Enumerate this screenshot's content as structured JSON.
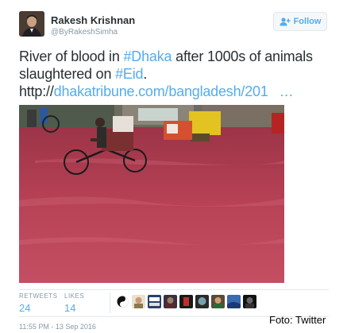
{
  "author": {
    "name": "Rakesh Krishnan",
    "handle": "@ByRakeshSimha",
    "avatar_icon": "profile-photo"
  },
  "follow_button": {
    "label": "Follow",
    "icon": "add-user-icon"
  },
  "tweet": {
    "line1_prefix": "River of blood in ",
    "hashtag1": "#Dhaka",
    "line1_suffix": " after 1000s of animals",
    "line2_prefix": "slaughtered on ",
    "hashtag2": "#Eid",
    "line2_suffix": ".",
    "url_scheme": "http://",
    "url_text": "dhakatribune.com/bangladesh/201",
    "ellipsis": "…"
  },
  "photo": {
    "description_icon": "flooded-street-photo"
  },
  "stats": {
    "retweets_label": "RETWEETS",
    "retweets_value": "24",
    "likes_label": "LIKES",
    "likes_value": "14"
  },
  "liker_avatars": [
    "liker-1",
    "liker-2",
    "liker-3",
    "liker-4",
    "liker-5",
    "liker-6",
    "liker-7",
    "liker-8",
    "liker-9"
  ],
  "timestamp": "11:55 PM - 13 Sep 2016",
  "credit": "Foto: Twitter",
  "colors": {
    "link": "#55acee",
    "text": "#292f33",
    "muted": "#8899a6",
    "border": "#e1e8ed",
    "blood_water": "#b84256"
  }
}
